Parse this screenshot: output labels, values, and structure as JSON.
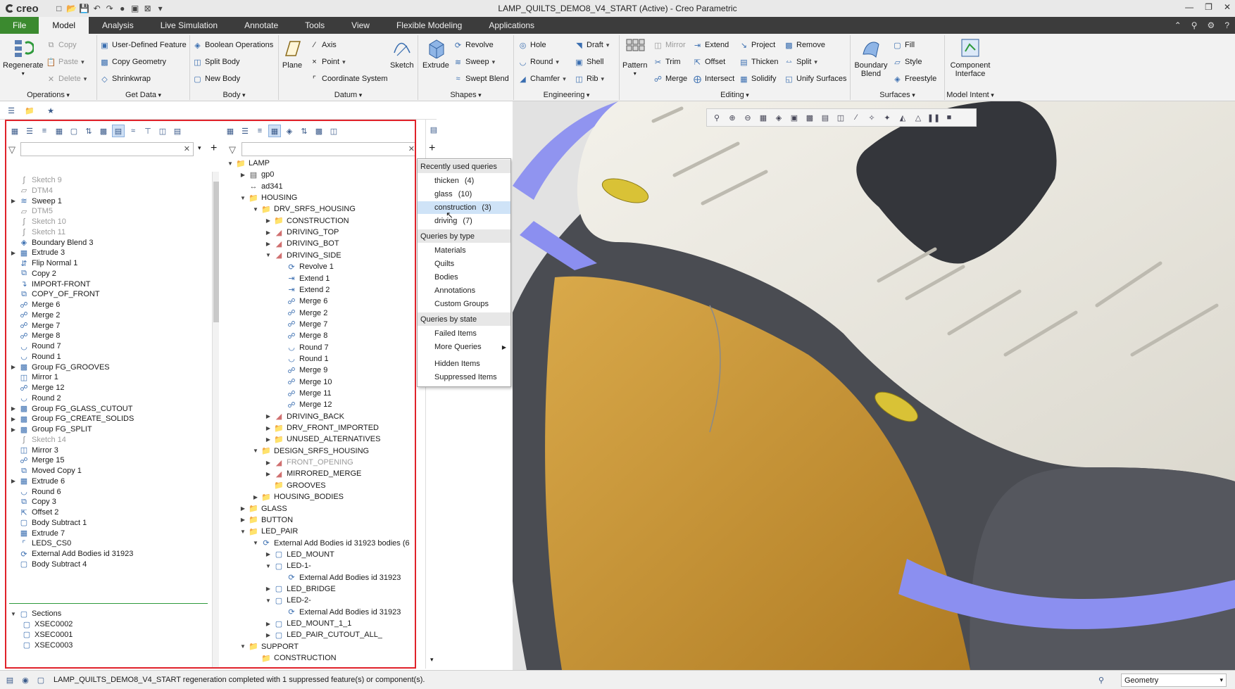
{
  "app": {
    "logo": "creo",
    "window_title": "LAMP_QUILTS_DEMO8_V4_START (Active) - Creo Parametric"
  },
  "tabs": [
    "File",
    "Model",
    "Analysis",
    "Live Simulation",
    "Annotate",
    "Tools",
    "View",
    "Flexible Modeling",
    "Applications"
  ],
  "ribbon": {
    "operations": {
      "label": "Operations",
      "regenerate": "Regenerate",
      "copy": "Copy",
      "paste": "Paste",
      "delete": "Delete"
    },
    "get_data": {
      "label": "Get Data",
      "udf": "User-Defined Feature",
      "copy_geometry": "Copy Geometry",
      "shrinkwrap": "Shrinkwrap"
    },
    "body": {
      "label": "Body",
      "boolean": "Boolean Operations",
      "split": "Split Body",
      "new": "New Body"
    },
    "datum": {
      "label": "Datum",
      "plane": "Plane",
      "axis": "Axis",
      "point": "Point",
      "csys": "Coordinate System",
      "sketch": "Sketch"
    },
    "shapes": {
      "label": "Shapes",
      "extrude": "Extrude",
      "revolve": "Revolve",
      "sweep": "Sweep",
      "swept_blend": "Swept Blend"
    },
    "engineering": {
      "label": "Engineering",
      "hole": "Hole",
      "round": "Round",
      "chamfer": "Chamfer",
      "draft": "Draft",
      "shell": "Shell",
      "rib": "Rib"
    },
    "editing": {
      "label": "Editing",
      "pattern": "Pattern",
      "mirror": "Mirror",
      "trim": "Trim",
      "merge": "Merge",
      "extend": "Extend",
      "offset": "Offset",
      "intersect": "Intersect",
      "project": "Project",
      "thicken": "Thicken",
      "solidify": "Solidify",
      "remove": "Remove",
      "split": "Split",
      "unify": "Unify Surfaces"
    },
    "surfaces": {
      "label": "Surfaces",
      "boundary_blend": "Boundary Blend",
      "fill": "Fill",
      "style": "Style",
      "freestyle": "Freestyle"
    },
    "model_intent": {
      "label": "Model Intent",
      "component_interface": "Component Interface"
    }
  },
  "left_tree": [
    {
      "label": "Sketch 9",
      "icon": "sketch-icon",
      "dim": true
    },
    {
      "label": "DTM4",
      "icon": "plane-icon",
      "dim": true
    },
    {
      "label": "Sweep 1",
      "icon": "sweep-icon",
      "exp": true
    },
    {
      "label": "DTM5",
      "icon": "plane-icon",
      "dim": true
    },
    {
      "label": "Sketch 10",
      "icon": "sketch-icon",
      "dim": true
    },
    {
      "label": "Sketch 11",
      "icon": "sketch-icon",
      "dim": true
    },
    {
      "label": "Boundary Blend 3",
      "icon": "blend-icon"
    },
    {
      "label": "Extrude 3",
      "icon": "extrude-icon",
      "exp": true
    },
    {
      "label": "Flip Normal 1",
      "icon": "flip-icon"
    },
    {
      "label": "Copy 2",
      "icon": "copy-icon"
    },
    {
      "label": "IMPORT-FRONT",
      "icon": "import-icon"
    },
    {
      "label": "COPY_OF_FRONT",
      "icon": "copy-icon"
    },
    {
      "label": "Merge 6",
      "icon": "merge-icon"
    },
    {
      "label": "Merge 2",
      "icon": "merge-icon"
    },
    {
      "label": "Merge 7",
      "icon": "merge-icon"
    },
    {
      "label": "Merge 8",
      "icon": "merge-icon"
    },
    {
      "label": "Round 7",
      "icon": "round-icon"
    },
    {
      "label": "Round 1",
      "icon": "round-icon"
    },
    {
      "label": "Group FG_GROOVES",
      "icon": "group-icon",
      "exp": true
    },
    {
      "label": "Mirror 1",
      "icon": "mirror-icon"
    },
    {
      "label": "Merge 12",
      "icon": "merge-icon"
    },
    {
      "label": "Round 2",
      "icon": "round-icon"
    },
    {
      "label": "Group FG_GLASS_CUTOUT",
      "icon": "group-icon",
      "exp": true
    },
    {
      "label": "Group FG_CREATE_SOLIDS",
      "icon": "group-icon",
      "exp": true
    },
    {
      "label": "Group FG_SPLIT",
      "icon": "group-icon",
      "exp": true
    },
    {
      "label": "Sketch 14",
      "icon": "sketch-icon",
      "dim": true
    },
    {
      "label": "Mirror 3",
      "icon": "mirror-icon"
    },
    {
      "label": "Merge 15",
      "icon": "merge-icon"
    },
    {
      "label": "Moved Copy 1",
      "icon": "copy-icon"
    },
    {
      "label": "Extrude 6",
      "icon": "extrude-icon",
      "exp": true
    },
    {
      "label": "Round 6",
      "icon": "round-icon"
    },
    {
      "label": "Copy 3",
      "icon": "copy-icon"
    },
    {
      "label": "Offset 2",
      "icon": "offset-icon"
    },
    {
      "label": "Body Subtract 1",
      "icon": "body-icon"
    },
    {
      "label": "Extrude 7",
      "icon": "extrude-icon"
    },
    {
      "label": "LEDS_CS0",
      "icon": "csys-icon"
    },
    {
      "label": "External Add Bodies id 31923",
      "icon": "external-icon"
    },
    {
      "label": "Body Subtract 4",
      "icon": "body-icon"
    }
  ],
  "sections": {
    "label": "Sections",
    "items": [
      "XSEC0002",
      "XSEC0001",
      "XSEC0003"
    ]
  },
  "model_tree": [
    {
      "l": 0,
      "t": "v",
      "i": "folder",
      "label": "LAMP"
    },
    {
      "l": 1,
      "t": ">",
      "i": "datum",
      "label": "gp0"
    },
    {
      "l": 1,
      "t": "",
      "i": "dim",
      "label": "ad341"
    },
    {
      "l": 1,
      "t": "v",
      "i": "folder",
      "label": "HOUSING"
    },
    {
      "l": 2,
      "t": "v",
      "i": "folder",
      "label": "DRV_SRFS_HOUSING"
    },
    {
      "l": 3,
      "t": ">",
      "i": "folder",
      "label": "CONSTRUCTION"
    },
    {
      "l": 3,
      "t": ">",
      "i": "quilt",
      "label": "DRIVING_TOP"
    },
    {
      "l": 3,
      "t": ">",
      "i": "quilt",
      "label": "DRIVING_BOT"
    },
    {
      "l": 3,
      "t": "v",
      "i": "quilt",
      "label": "DRIVING_SIDE"
    },
    {
      "l": 4,
      "t": "",
      "i": "revolve",
      "label": "Revolve 1"
    },
    {
      "l": 4,
      "t": "",
      "i": "extend",
      "label": "Extend 1"
    },
    {
      "l": 4,
      "t": "",
      "i": "extend",
      "label": "Extend 2"
    },
    {
      "l": 4,
      "t": "",
      "i": "merge",
      "label": "Merge 6"
    },
    {
      "l": 4,
      "t": "",
      "i": "merge",
      "label": "Merge 2"
    },
    {
      "l": 4,
      "t": "",
      "i": "merge",
      "label": "Merge 7"
    },
    {
      "l": 4,
      "t": "",
      "i": "merge",
      "label": "Merge 8"
    },
    {
      "l": 4,
      "t": "",
      "i": "round",
      "label": "Round 7"
    },
    {
      "l": 4,
      "t": "",
      "i": "round",
      "label": "Round 1"
    },
    {
      "l": 4,
      "t": "",
      "i": "merge",
      "label": "Merge 9"
    },
    {
      "l": 4,
      "t": "",
      "i": "merge",
      "label": "Merge 10"
    },
    {
      "l": 4,
      "t": "",
      "i": "merge",
      "label": "Merge 11"
    },
    {
      "l": 4,
      "t": "",
      "i": "merge",
      "label": "Merge 12"
    },
    {
      "l": 3,
      "t": ">",
      "i": "quilt",
      "label": "DRIVING_BACK"
    },
    {
      "l": 3,
      "t": ">",
      "i": "folder",
      "label": "DRV_FRONT_IMPORTED"
    },
    {
      "l": 3,
      "t": ">",
      "i": "folder",
      "label": "UNUSED_ALTERNATIVES"
    },
    {
      "l": 2,
      "t": "v",
      "i": "folder",
      "label": "DESIGN_SRFS_HOUSING"
    },
    {
      "l": 3,
      "t": ">",
      "i": "quilt",
      "label": "FRONT_OPENING",
      "dim": true
    },
    {
      "l": 3,
      "t": ">",
      "i": "quilt",
      "label": "MIRRORED_MERGE"
    },
    {
      "l": 3,
      "t": "",
      "i": "folder",
      "label": "GROOVES"
    },
    {
      "l": 2,
      "t": ">",
      "i": "folder",
      "label": "HOUSING_BODIES"
    },
    {
      "l": 1,
      "t": ">",
      "i": "folder",
      "label": "GLASS"
    },
    {
      "l": 1,
      "t": ">",
      "i": "folder",
      "label": "BUTTON"
    },
    {
      "l": 1,
      "t": "v",
      "i": "folder",
      "label": "LED_PAIR"
    },
    {
      "l": 2,
      "t": "v",
      "i": "ext",
      "label": "External Add Bodies id 31923 bodies (6"
    },
    {
      "l": 3,
      "t": ">",
      "i": "body",
      "label": "LED_MOUNT"
    },
    {
      "l": 3,
      "t": "v",
      "i": "body",
      "label": "LED-1-"
    },
    {
      "l": 4,
      "t": "",
      "i": "ext",
      "label": "External Add Bodies id 31923"
    },
    {
      "l": 3,
      "t": ">",
      "i": "body",
      "label": "LED_BRIDGE"
    },
    {
      "l": 3,
      "t": "v",
      "i": "body",
      "label": "LED-2-"
    },
    {
      "l": 4,
      "t": "",
      "i": "ext",
      "label": "External Add Bodies id 31923"
    },
    {
      "l": 3,
      "t": ">",
      "i": "body",
      "label": "LED_MOUNT_1_1"
    },
    {
      "l": 3,
      "t": ">",
      "i": "body",
      "label": "LED_PAIR_CUTOUT_ALL_"
    },
    {
      "l": 1,
      "t": "v",
      "i": "folder",
      "label": "SUPPORT"
    },
    {
      "l": 2,
      "t": "",
      "i": "folder",
      "label": "CONSTRUCTION"
    }
  ],
  "popup": {
    "recent_header": "Recently used queries",
    "recent": [
      {
        "label": "thicken",
        "count": "(4)"
      },
      {
        "label": "glass",
        "count": "(10)"
      },
      {
        "label": "construction",
        "count": "(3)"
      },
      {
        "label": "driving",
        "count": "(7)"
      }
    ],
    "type_header": "Queries by type",
    "types": [
      "Materials",
      "Quilts",
      "Bodies",
      "Annotations",
      "Custom Groups"
    ],
    "state_header": "Queries by state",
    "states": [
      "Failed Items",
      "More Queries"
    ],
    "extras": [
      "Hidden Items",
      "Suppressed Items"
    ]
  },
  "status": {
    "message": "LAMP_QUILTS_DEMO8_V4_START regeneration completed with 1 suppressed feature(s) or component(s).",
    "filter": "Geometry"
  },
  "colors": {
    "file_tab": "#3b8a2f",
    "highlight_border": "#e0222a",
    "quilt_blue": "#8b8ff0",
    "housing_white": "#efece4",
    "interior_orange": "#c89a3a"
  }
}
